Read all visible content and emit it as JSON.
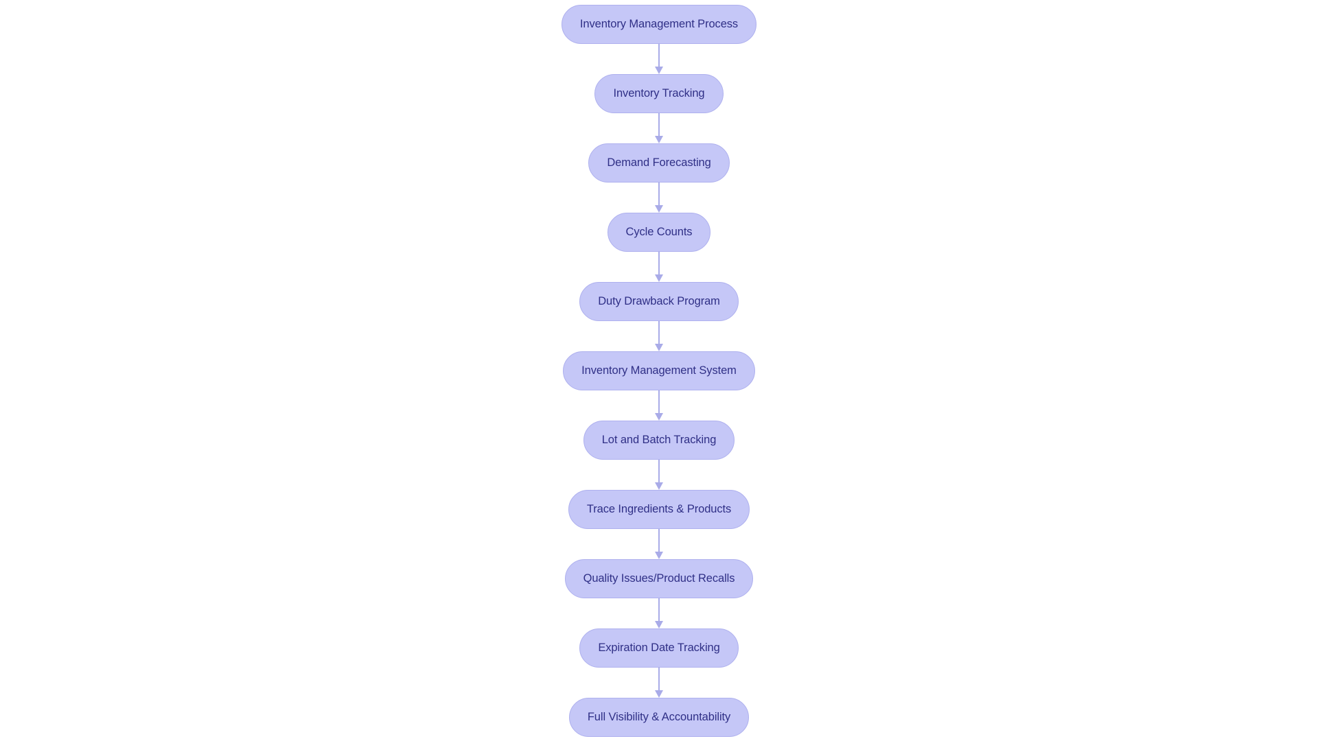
{
  "diagram": {
    "title": "Inventory Management Process",
    "type": "flowchart",
    "orientation": "vertical",
    "background_color": "#ffffff",
    "node_fill_color": "#c5c7f7",
    "node_border_color": "#aeb0ee",
    "node_text_color": "#2f2f86",
    "connector_color": "#a9abe8",
    "nodes": [
      {
        "id": "n1",
        "label": "Inventory Management Process"
      },
      {
        "id": "n2",
        "label": "Inventory Tracking"
      },
      {
        "id": "n3",
        "label": "Demand Forecasting"
      },
      {
        "id": "n4",
        "label": "Cycle Counts"
      },
      {
        "id": "n5",
        "label": "Duty Drawback Program"
      },
      {
        "id": "n6",
        "label": "Inventory Management System"
      },
      {
        "id": "n7",
        "label": "Lot and Batch Tracking"
      },
      {
        "id": "n8",
        "label": "Trace Ingredients & Products"
      },
      {
        "id": "n9",
        "label": "Quality Issues/Product Recalls"
      },
      {
        "id": "n10",
        "label": "Expiration Date Tracking"
      },
      {
        "id": "n11",
        "label": "Full Visibility & Accountability"
      }
    ],
    "edges": [
      {
        "from": "n1",
        "to": "n2"
      },
      {
        "from": "n2",
        "to": "n3"
      },
      {
        "from": "n3",
        "to": "n4"
      },
      {
        "from": "n4",
        "to": "n5"
      },
      {
        "from": "n5",
        "to": "n6"
      },
      {
        "from": "n6",
        "to": "n7"
      },
      {
        "from": "n7",
        "to": "n8"
      },
      {
        "from": "n8",
        "to": "n9"
      },
      {
        "from": "n9",
        "to": "n10"
      },
      {
        "from": "n10",
        "to": "n11"
      }
    ]
  }
}
